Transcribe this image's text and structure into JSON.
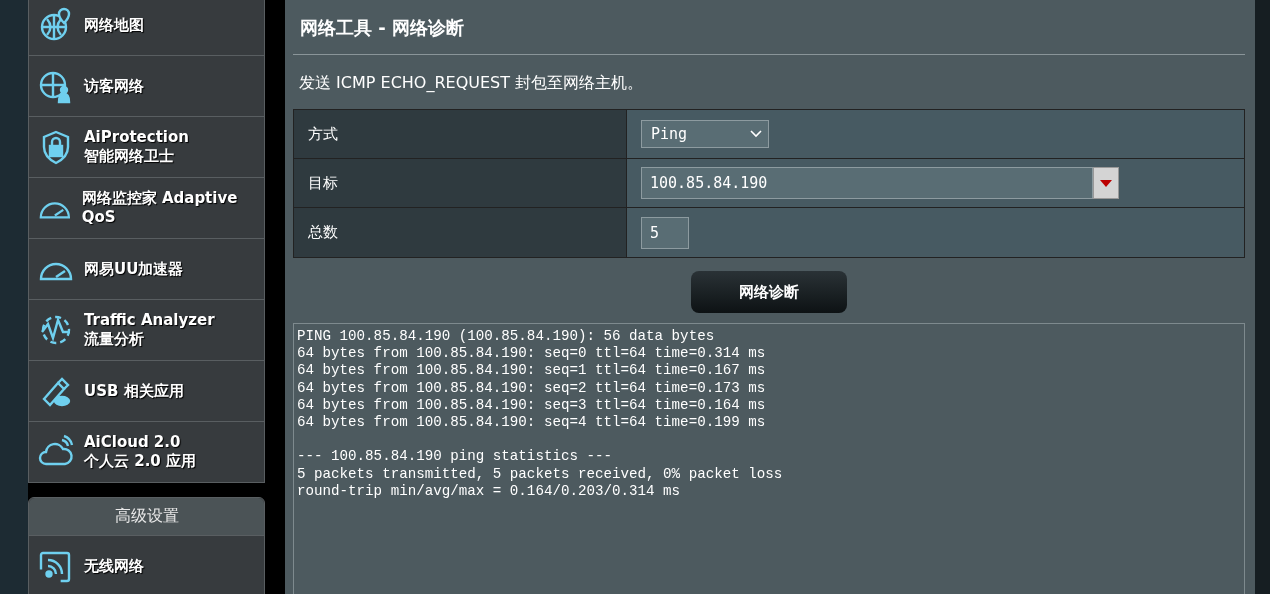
{
  "sidebar": {
    "items": [
      {
        "label": "网络地图"
      },
      {
        "label": "访客网络"
      },
      {
        "label": "AiProtection",
        "sublabel": "智能网络卫士"
      },
      {
        "label": "网络监控家 Adaptive QoS"
      },
      {
        "label": "网易UU加速器"
      },
      {
        "label": "Traffic Analyzer",
        "sublabel": "流量分析"
      },
      {
        "label": "USB 相关应用"
      },
      {
        "label": "AiCloud 2.0",
        "sublabel": "个人云 2.0 应用"
      }
    ],
    "advanced": {
      "title": "高级设置",
      "items": [
        {
          "label": "无线网络"
        }
      ]
    }
  },
  "main": {
    "title": "网络工具 - 网络诊断",
    "description": "发送 ICMP ECHO_REQUEST 封包至网络主机。",
    "form": [
      {
        "kind": "select",
        "label": "方式",
        "value": "Ping"
      },
      {
        "kind": "combo",
        "label": "目标",
        "value": "100.85.84.190"
      },
      {
        "kind": "text",
        "label": "总数",
        "value": "5"
      }
    ],
    "button": "网络诊断",
    "output": "PING 100.85.84.190 (100.85.84.190): 56 data bytes\n64 bytes from 100.85.84.190: seq=0 ttl=64 time=0.314 ms\n64 bytes from 100.85.84.190: seq=1 ttl=64 time=0.167 ms\n64 bytes from 100.85.84.190: seq=2 ttl=64 time=0.173 ms\n64 bytes from 100.85.84.190: seq=3 ttl=64 time=0.164 ms\n64 bytes from 100.85.84.190: seq=4 ttl=64 time=0.199 ms\n\n--- 100.85.84.190 ping statistics ---\n5 packets transmitted, 5 packets received, 0% packet loss\nround-trip min/avg/max = 0.164/0.203/0.314 ms"
  }
}
